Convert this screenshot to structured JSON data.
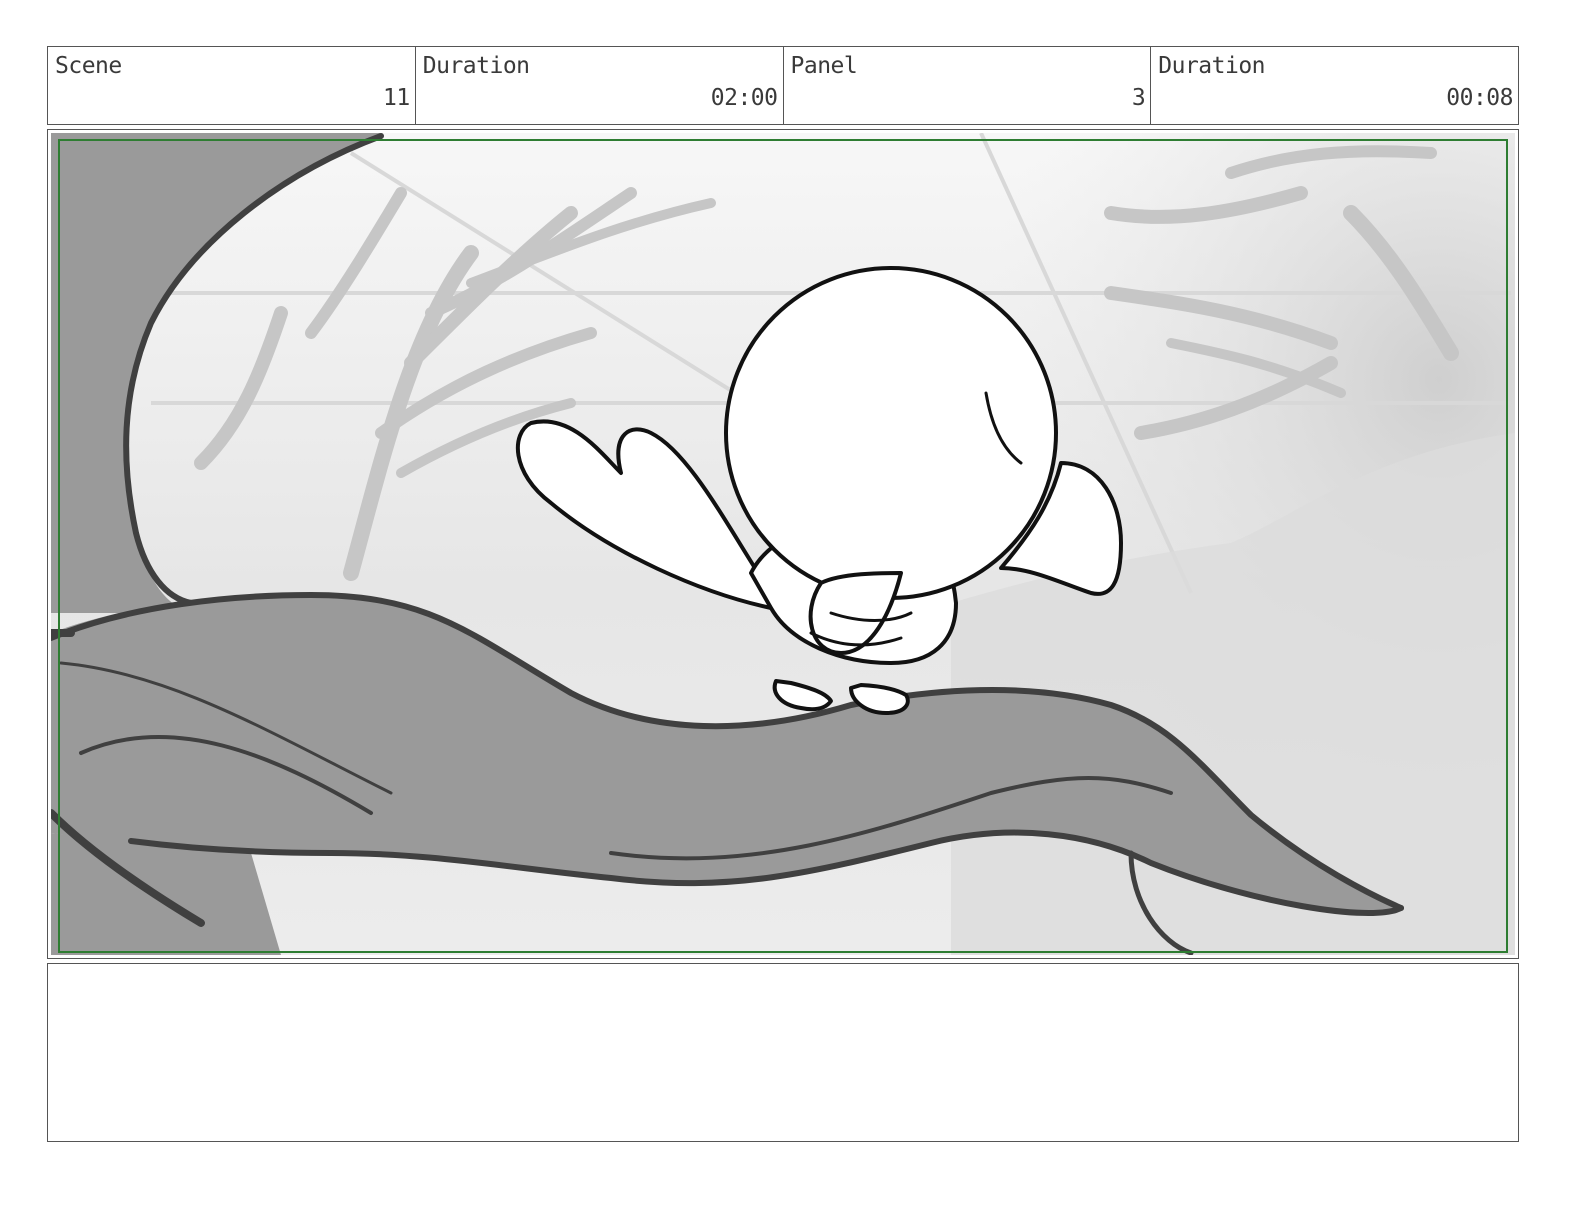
{
  "header": {
    "scene_label": "Scene",
    "scene_value": "11",
    "scene_duration_label": "Duration",
    "scene_duration_value": "02:00",
    "panel_label": "Panel",
    "panel_value": "3",
    "panel_duration_label": "Duration",
    "panel_duration_value": "00:08"
  },
  "notes": {
    "text": ""
  },
  "colors": {
    "border": "#555555",
    "safe_frame": "#2e7d32",
    "branch_fill": "#9a9a9a",
    "branch_outline": "#404040"
  }
}
